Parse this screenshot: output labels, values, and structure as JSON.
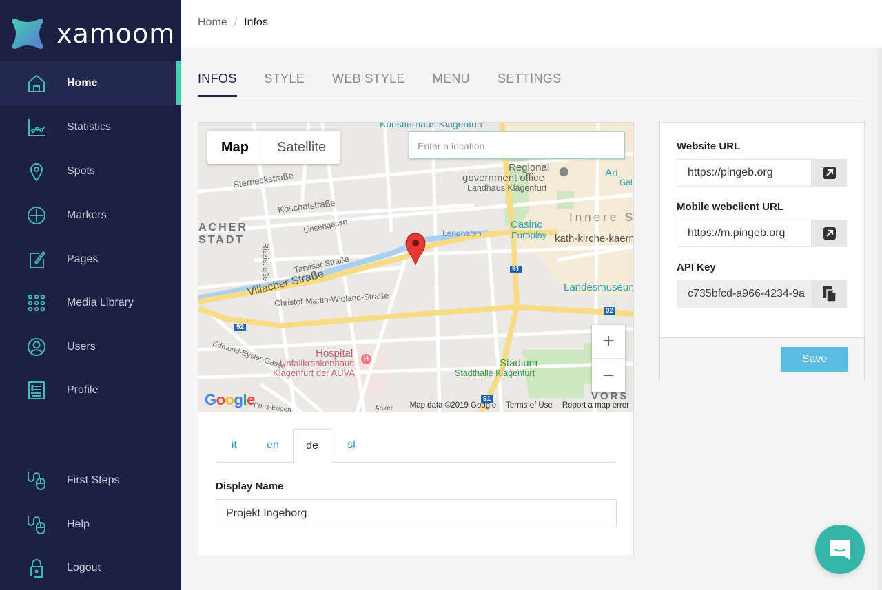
{
  "app": {
    "name": "xamoom"
  },
  "sidebar": {
    "items": [
      {
        "label": "Home",
        "icon": "home-icon",
        "active": true
      },
      {
        "label": "Statistics",
        "icon": "statistics-icon"
      },
      {
        "label": "Spots",
        "icon": "location-pin-icon"
      },
      {
        "label": "Markers",
        "icon": "plus-circle-icon"
      },
      {
        "label": "Pages",
        "icon": "edit-page-icon"
      },
      {
        "label": "Media Library",
        "icon": "grid-dots-icon"
      },
      {
        "label": "Users",
        "icon": "user-circle-icon"
      },
      {
        "label": "Profile",
        "icon": "list-icon"
      }
    ],
    "bottom_items": [
      {
        "label": "First Steps",
        "icon": "mouse-cable-icon"
      },
      {
        "label": "Help",
        "icon": "mouse-cable-icon"
      },
      {
        "label": "Logout",
        "icon": "lock-icon"
      }
    ]
  },
  "breadcrumb": {
    "home": "Home",
    "separator": "/",
    "current": "Infos"
  },
  "tabs": [
    {
      "label": "INFOS",
      "active": true
    },
    {
      "label": "STYLE"
    },
    {
      "label": "WEB STYLE"
    },
    {
      "label": "MENU"
    },
    {
      "label": "SETTINGS"
    }
  ],
  "map": {
    "type_options": [
      "Map",
      "Satellite"
    ],
    "selected_type": "Map",
    "search_placeholder": "Enter a location",
    "zoom_in": "+",
    "zoom_out": "−",
    "attribution": "Map data ©2019 Google",
    "terms": "Terms of Use",
    "report": "Report a map error",
    "google_logo": "Google",
    "labels": {
      "kunstlerhaus": "Künstlerhaus Klagenfurt",
      "regional": "Regional",
      "government": "government office",
      "landhaus": "Landhaus Klagenfurt",
      "art": "Art",
      "gal": "Gal",
      "sterneck": "Sterneckstraße",
      "koschat": "Koschatstraße",
      "acher": "ACHER",
      "stadt": "STADT",
      "rizzi": "Rizzistraße",
      "linsen": "Linsengasse",
      "innere": "Innere S",
      "casino": "Casino",
      "europlay": "Europlay",
      "kath": "kath-kirche-kaern",
      "lendhafen": "Lendhafen",
      "tarviser": "Tarviser Straße",
      "villacher": "Villacher Straße",
      "christof": "Christof-Martin-Wieland-Straße",
      "landesmuseum": "Landesmuseum",
      "route91": "91",
      "route92": "92",
      "edmund": "Edmund-Eysler-Gasse",
      "hospital": "Hospital",
      "unfall": "Unfallkrankenhaus",
      "klagenfurt_auva": "Klagenfurt der AUVA",
      "stadium": "Stadium",
      "stadthalle": "Stadthalle Klagenfurt",
      "vors": "VORS",
      "prinz": "Prinz-Eugen",
      "anker": "Anker"
    }
  },
  "languages": [
    {
      "code": "it"
    },
    {
      "code": "en"
    },
    {
      "code": "de",
      "active": true
    },
    {
      "code": "sl"
    }
  ],
  "form": {
    "display_name_label": "Display Name",
    "display_name_value": "Projekt Ingeborg"
  },
  "settings_card": {
    "website_url_label": "Website URL",
    "website_url_value": "https://pingeb.org",
    "mobile_url_label": "Mobile webclient URL",
    "mobile_url_value": "https://m.pingeb.org",
    "api_key_label": "API Key",
    "api_key_value": "c735bfcd-a966-4234-9a",
    "save_label": "Save"
  },
  "colors": {
    "sidebar_bg": "#1c2042",
    "accent_teal": "#3fd3b0",
    "icon_teal": "#43b8b5",
    "save_blue": "#5bbde3",
    "lang_link": "#2a9dc0",
    "chat_bg": "#33b5a8"
  }
}
